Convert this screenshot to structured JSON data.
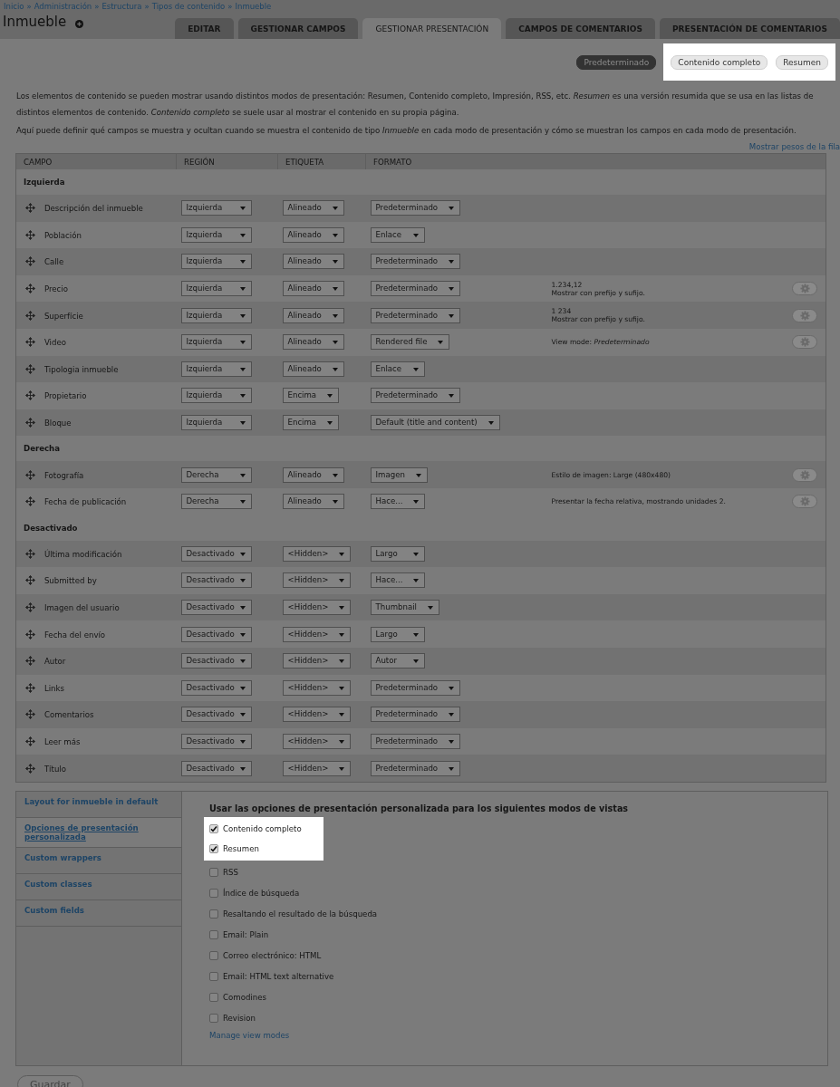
{
  "breadcrumb": {
    "separator": "»",
    "items": [
      "Inicio",
      "Administración",
      "Estructura",
      "Tipos de contenido",
      "Inmueble"
    ]
  },
  "title": "Inmueble",
  "tabs": [
    {
      "label": "EDITAR",
      "selected": false
    },
    {
      "label": "GESTIONAR CAMPOS",
      "selected": false
    },
    {
      "label": "GESTIONAR PRESENTACIÓN",
      "selected": true
    },
    {
      "label": "CAMPOS DE COMENTARIOS",
      "selected": false
    },
    {
      "label": "PRESENTACIÓN DE COMENTARIOS",
      "selected": false
    }
  ],
  "view_modes": [
    {
      "label": "Predeterminado",
      "selected": true,
      "highlighted": false
    },
    {
      "label": "Contenido completo",
      "selected": false,
      "highlighted": true
    },
    {
      "label": "Resumen",
      "selected": false,
      "highlighted": true
    }
  ],
  "description": [
    "Los elementos de contenido se pueden mostrar usando distintos modos de presentación: Resumen, Contenido completo, Impresión, RSS, etc. *Resumen* es una versión resumida que se usa en las listas de distintos elementos de contenido. *Contenido completo* se suele usar al mostrar el contenido en su propia página.",
    "Aquí puede definir qué campos se muestra y ocultan cuando se muestra el contenido de tipo *Inmueble* en cada modo de presentación y cómo se muestran los campos en cada modo de presentación."
  ],
  "row_weights_link": "Mostrar pesos de la fila",
  "table": {
    "columns": [
      "CAMPO",
      "REGIÓN",
      "ETIQUETA",
      "FORMATO"
    ],
    "groups": [
      {
        "title": "Izquierda",
        "rows": [
          {
            "field": "Descripción del inmueble",
            "region": "Izquierda",
            "label": "Alineado",
            "format": "Predeterminado",
            "summary": [],
            "settings_button": false
          },
          {
            "field": "Población",
            "region": "Izquierda",
            "label": "Alineado",
            "format": "Enlace",
            "summary": [],
            "settings_button": false
          },
          {
            "field": "Calle",
            "region": "Izquierda",
            "label": "Alineado",
            "format": "Predeterminado",
            "summary": [],
            "settings_button": false
          },
          {
            "field": "Precio",
            "region": "Izquierda",
            "label": "Alineado",
            "format": "Predeterminado",
            "summary": [
              "1.234,12",
              "Mostrar con prefijo y sufijo."
            ],
            "settings_button": true
          },
          {
            "field": "Superfície",
            "region": "Izquierda",
            "label": "Alineado",
            "format": "Predeterminado",
            "summary": [
              "1 234",
              "Mostrar con prefijo y sufijo."
            ],
            "settings_button": true
          },
          {
            "field": "Video",
            "region": "Izquierda",
            "label": "Alineado",
            "format": "Rendered file",
            "summary": [
              "View mode: *Predeterminado*"
            ],
            "settings_button": true
          },
          {
            "field": "Tipologia inmueble",
            "region": "Izquierda",
            "label": "Alineado",
            "format": "Enlace",
            "summary": [],
            "settings_button": false
          },
          {
            "field": "Propietario",
            "region": "Izquierda",
            "label": "Encima",
            "format": "Predeterminado",
            "summary": [],
            "settings_button": false
          },
          {
            "field": "Bloque",
            "region": "Izquierda",
            "label": "Encima",
            "format": "Default (title and content)",
            "summary": [],
            "settings_button": false
          }
        ]
      },
      {
        "title": "Derecha",
        "rows": [
          {
            "field": "Fotografía",
            "region": "Derecha",
            "label": "Alineado",
            "format": "Imagen",
            "summary": [
              "Estilo de imagen: Large (480x480)"
            ],
            "settings_button": true
          },
          {
            "field": "Fecha de publicación",
            "region": "Derecha",
            "label": "Alineado",
            "format": "Hace...",
            "summary": [
              "Presentar la fecha relativa, mostrando unidades 2."
            ],
            "settings_button": true
          }
        ]
      },
      {
        "title": "Desactivado",
        "rows": [
          {
            "field": "Última modificación",
            "region": "Desactivado",
            "label": "<Hidden>",
            "format": "Largo",
            "summary": [],
            "settings_button": false
          },
          {
            "field": "Submitted by",
            "region": "Desactivado",
            "label": "<Hidden>",
            "format": "Hace...",
            "summary": [],
            "settings_button": false
          },
          {
            "field": "Imagen del usuario",
            "region": "Desactivado",
            "label": "<Hidden>",
            "format": "Thumbnail",
            "summary": [],
            "settings_button": false
          },
          {
            "field": "Fecha del envío",
            "region": "Desactivado",
            "label": "<Hidden>",
            "format": "Largo",
            "summary": [],
            "settings_button": false
          },
          {
            "field": "Autor",
            "region": "Desactivado",
            "label": "<Hidden>",
            "format": "Autor",
            "summary": [],
            "settings_button": false
          },
          {
            "field": "Links",
            "region": "Desactivado",
            "label": "<Hidden>",
            "format": "Predeterminado",
            "summary": [],
            "settings_button": false
          },
          {
            "field": "Comentarios",
            "region": "Desactivado",
            "label": "<Hidden>",
            "format": "Predeterminado",
            "summary": [],
            "settings_button": false
          },
          {
            "field": "Leer más",
            "region": "Desactivado",
            "label": "<Hidden>",
            "format": "Predeterminado",
            "summary": [],
            "settings_button": false
          },
          {
            "field": "Título",
            "region": "Desactivado",
            "label": "<Hidden>",
            "format": "Predeterminado",
            "summary": [],
            "settings_button": false
          }
        ]
      }
    ]
  },
  "vertical_tabs": [
    {
      "label": "Layout for inmueble in default",
      "selected": false
    },
    {
      "label": "Opciones de presentación personalizada",
      "selected": true
    },
    {
      "label": "Custom wrappers",
      "selected": false
    },
    {
      "label": "Custom classes",
      "selected": false
    },
    {
      "label": "Custom fields",
      "selected": false
    }
  ],
  "panel": {
    "heading": "Usar las opciones de presentación personalizada para los siguientes modos de vistas",
    "checkboxes": [
      {
        "label": "Contenido completo",
        "checked": true,
        "highlighted": true
      },
      {
        "label": "Resumen",
        "checked": true,
        "highlighted": true
      },
      {
        "label": "RSS",
        "checked": false,
        "highlighted": false
      },
      {
        "label": "Índice de búsqueda",
        "checked": false,
        "highlighted": false
      },
      {
        "label": "Resaltando el resultado de la búsqueda",
        "checked": false,
        "highlighted": false
      },
      {
        "label": "Email: Plain",
        "checked": false,
        "highlighted": false
      },
      {
        "label": "Correo electrónico: HTML",
        "checked": false,
        "highlighted": false
      },
      {
        "label": "Email: HTML text alternative",
        "checked": false,
        "highlighted": false
      },
      {
        "label": "Comodines",
        "checked": false,
        "highlighted": false
      },
      {
        "label": "Revision",
        "checked": false,
        "highlighted": false
      }
    ],
    "link": "Manage view modes"
  },
  "save_button": "Guardar"
}
